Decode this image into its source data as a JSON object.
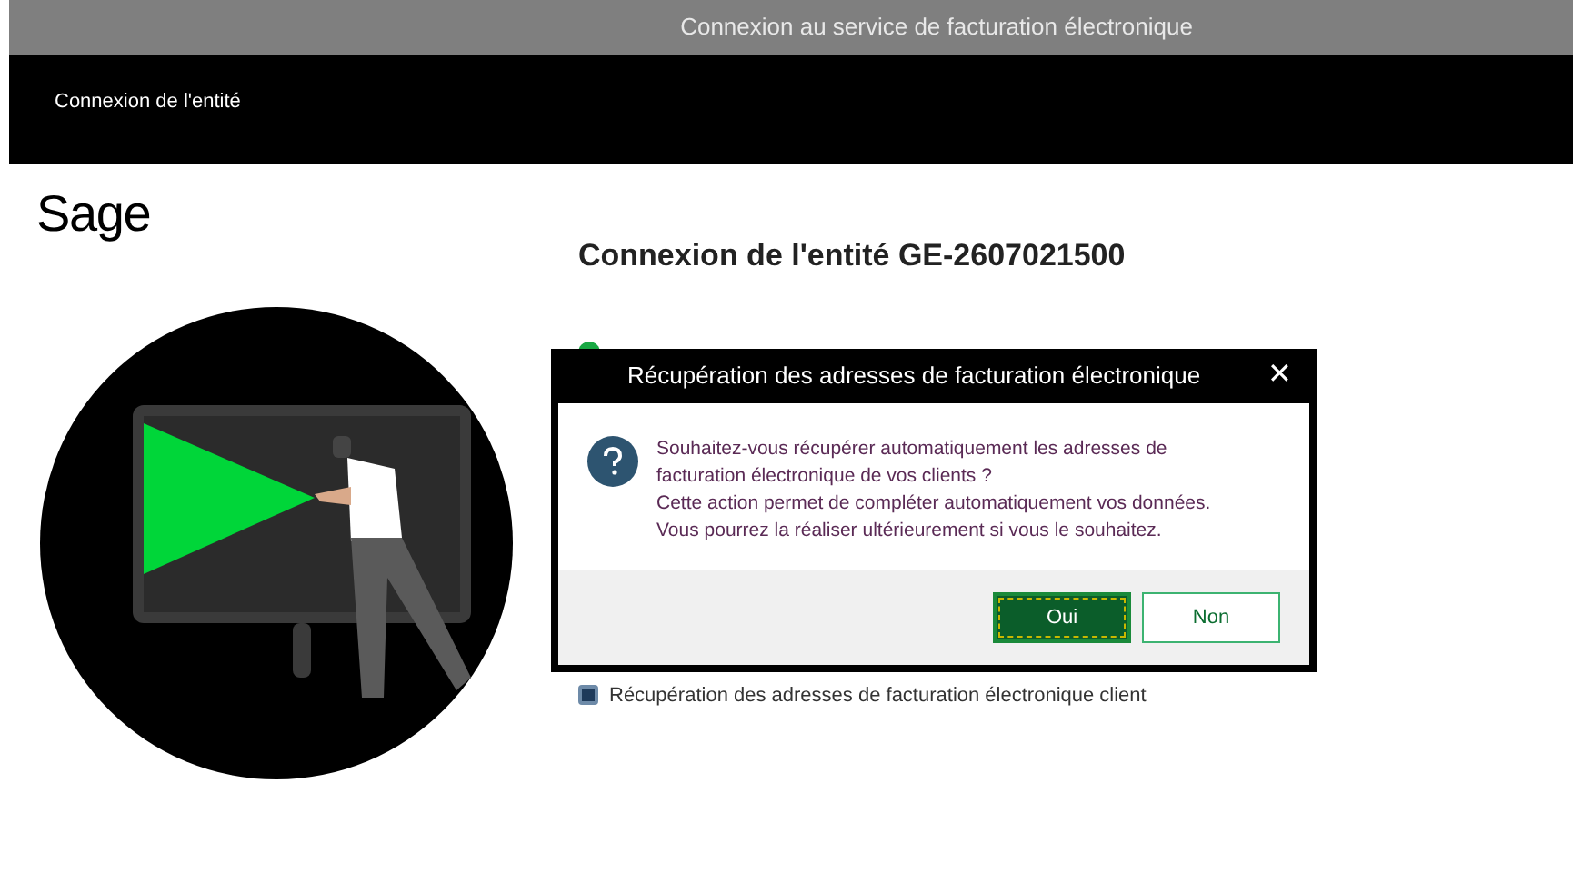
{
  "window": {
    "title": "Connexion au service de facturation électronique"
  },
  "header": {
    "title": "Connexion de l'entité"
  },
  "logo": "Sage",
  "heading": "Connexion de l'entité GE-2607021500",
  "steps": [
    {
      "kind": "done"
    },
    {
      "kind": "pending",
      "label": "Récupération des adresses de facturation électronique client"
    }
  ],
  "dialog": {
    "title": "Récupération des adresses de facturation électronique",
    "message_lines": [
      "Souhaitez-vous récupérer automatiquement les adresses de",
      "facturation électronique de vos clients ?",
      "Cette action permet de compléter automatiquement vos données.",
      "Vous pourrez la réaliser ultérieurement si vous le souhaitez."
    ],
    "close": "✕",
    "buttons": [
      {
        "label": "Oui",
        "selected": true
      },
      {
        "label": "Non",
        "selected": false
      }
    ]
  }
}
